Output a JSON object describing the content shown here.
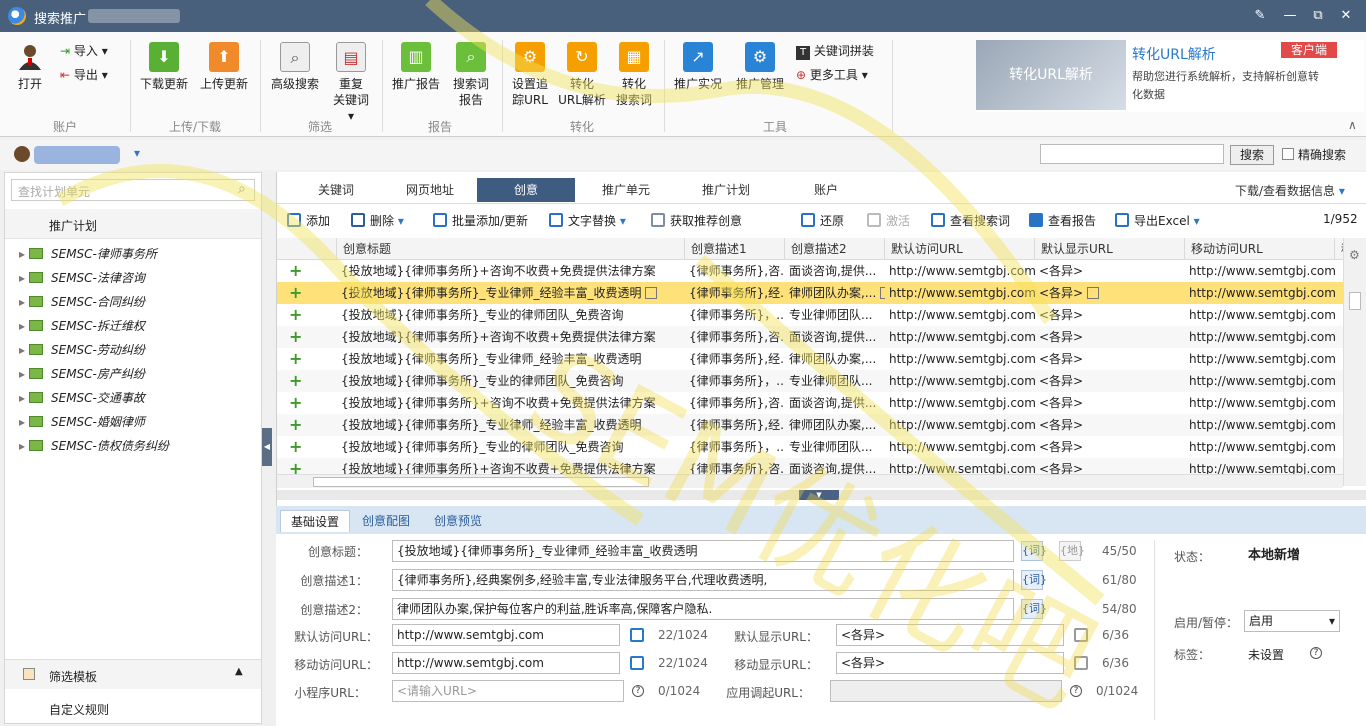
{
  "window": {
    "title": "搜索推广",
    "minimize": "—",
    "maximize": "▭",
    "close": "✕",
    "restore": "⧉"
  },
  "ribbon": {
    "account": {
      "open": "打开",
      "import": "导入",
      "export": "导出",
      "group": "账户"
    },
    "updown": {
      "download": "下载更新",
      "upload": "上传更新",
      "group": "上传/下载"
    },
    "filter": {
      "advanced": "高级搜索",
      "dup": "重复",
      "dup2": "关键词",
      "group": "筛选"
    },
    "report": {
      "promo": "推广报告",
      "search1": "搜索词",
      "search2": "报告",
      "group": "报告"
    },
    "convert": {
      "track1": "设置追",
      "track2": "踪URL",
      "url1": "转化",
      "url2": "URL解析",
      "sw1": "转化",
      "sw2": "搜索词",
      "group": "转化"
    },
    "tools": {
      "live": "推广实况",
      "manage": "推广管理",
      "kw": "关键词拼装",
      "more": "更多工具",
      "group": "工具"
    },
    "promo": {
      "title": "转化URL解析",
      "badge": "客户端",
      "desc": "帮助您进行系统解析，支持解析创意转化数据",
      "banner": "转化URL解析"
    }
  },
  "account_bar": {
    "search_btn": "搜索",
    "exact": "精确搜索"
  },
  "left": {
    "search_placeholder": "查找计划单元",
    "header": "推广计划",
    "plans": [
      "SEMSC-律师事务所",
      "SEMSC-法律咨询",
      "SEMSC-合同纠纷",
      "SEMSC-拆迁维权",
      "SEMSC-劳动纠纷",
      "SEMSC-房产纠纷",
      "SEMSC-交通事故",
      "SEMSC-婚姻律师",
      "SEMSC-债权债务纠纷"
    ],
    "filter_tpl": "筛选模板",
    "custom_rule": "自定义规则"
  },
  "tabs": [
    "关键词",
    "网页地址",
    "创意",
    "推广单元",
    "推广计划",
    "账户"
  ],
  "download_view": "下载/查看数据信息",
  "toolbar": {
    "add": "添加",
    "delete": "删除",
    "batch": "批量添加/更新",
    "replace": "文字替换",
    "fetch": "获取推荐创意",
    "restore": "还原",
    "activate": "激活",
    "view_search": "查看搜索词",
    "view_report": "查看报告",
    "export": "导出Excel",
    "pager": "1/952"
  },
  "grid": {
    "headers": [
      "创意标题",
      "创意描述1",
      "创意描述2",
      "默认访问URL",
      "默认显示URL",
      "移动访问URL",
      "移"
    ],
    "rows": [
      [
        "{投放地域}{律师事务所}+咨询不收费+免费提供法律方案",
        "{律师事务所},咨...",
        "面谈咨询,提供...",
        "http://www.semtgbj.com",
        "<各异>",
        "http://www.semtgbj.com"
      ],
      [
        "{投放地域}{律师事务所}_专业律师_经验丰富_收费透明",
        "{律师事务所},经...",
        "律师团队办案,...",
        "http://www.semtgbj.com",
        "<各异>",
        "http://www.semtgbj.com"
      ],
      [
        "{投放地域}{律师事务所}_专业的律师团队_免费咨询",
        "{律师事务所}，...",
        "专业律师团队...",
        "http://www.semtgbj.com",
        "<各异>",
        "http://www.semtgbj.com"
      ],
      [
        "{投放地域}{律师事务所}+咨询不收费+免费提供法律方案",
        "{律师事务所},咨...",
        "面谈咨询,提供...",
        "http://www.semtgbj.com",
        "<各异>",
        "http://www.semtgbj.com"
      ],
      [
        "{投放地域}{律师事务所}_专业律师_经验丰富_收费透明",
        "{律师事务所},经...",
        "律师团队办案,...",
        "http://www.semtgbj.com",
        "<各异>",
        "http://www.semtgbj.com"
      ],
      [
        "{投放地域}{律师事务所}_专业的律师团队_免费咨询",
        "{律师事务所}，...",
        "专业律师团队...",
        "http://www.semtgbj.com",
        "<各异>",
        "http://www.semtgbj.com"
      ],
      [
        "{投放地域}{律师事务所}+咨询不收费+免费提供法律方案",
        "{律师事务所},咨...",
        "面谈咨询,提供...",
        "http://www.semtgbj.com",
        "<各异>",
        "http://www.semtgbj.com"
      ],
      [
        "{投放地域}{律师事务所}_专业律师_经验丰富_收费透明",
        "{律师事务所},经...",
        "律师团队办案,...",
        "http://www.semtgbj.com",
        "<各异>",
        "http://www.semtgbj.com"
      ],
      [
        "{投放地域}{律师事务所}_专业的律师团队_免费咨询",
        "{律师事务所}，...",
        "专业律师团队...",
        "http://www.semtgbj.com",
        "<各异>",
        "http://www.semtgbj.com"
      ],
      [
        "{投放地域}{律师事务所}+咨询不收费+免费提供法律方案",
        "{律师事务所},咨...",
        "面谈咨询,提供...",
        "http://www.semtgbj.com",
        "<各异>",
        "http://www.semtgbj.com"
      ]
    ]
  },
  "detail": {
    "tabs": [
      "基础设置",
      "创意配图",
      "创意预览"
    ],
    "title_label": "创意标题：",
    "title": "{投放地域}{律师事务所}_专业律师_经验丰富_收费透明",
    "title_cnt": "45/50",
    "d1_label": "创意描述1：",
    "d1": "{律师事务所},经典案例多,经验丰富,专业法律服务平台,代理收费透明,",
    "d1_cnt": "61/80",
    "d2_label": "创意描述2：",
    "d2": "律师团队办案,保护每位客户的利益,胜诉率高,保障客户隐私.",
    "d2_cnt": "54/80",
    "w_btn": "{词}",
    "d_btn": "{地}",
    "url_label": "默认访问URL：",
    "url": "http://www.semtgbj.com",
    "url_cnt": "22/1024",
    "durl_label": "默认显示URL：",
    "durl": "<各异>",
    "durl_cnt": "6/36",
    "murl_label": "移动访问URL：",
    "murl": "http://www.semtgbj.com",
    "murl_cnt": "22/1024",
    "mdurl_label": "移动显示URL：",
    "mdurl": "<各异>",
    "mdurl_cnt": "6/36",
    "app_label": "小程序URL：",
    "app_ph": "<请输入URL>",
    "app_cnt": "0/1024",
    "call_label": "应用调起URL：",
    "call_cnt": "0/1024",
    "status_label": "状态：",
    "status": "本地新增",
    "enable_label": "启用/暂停：",
    "enable": "启用",
    "tag_label": "标签：",
    "tag": "未设置"
  },
  "watermark": "SEM优化吧"
}
